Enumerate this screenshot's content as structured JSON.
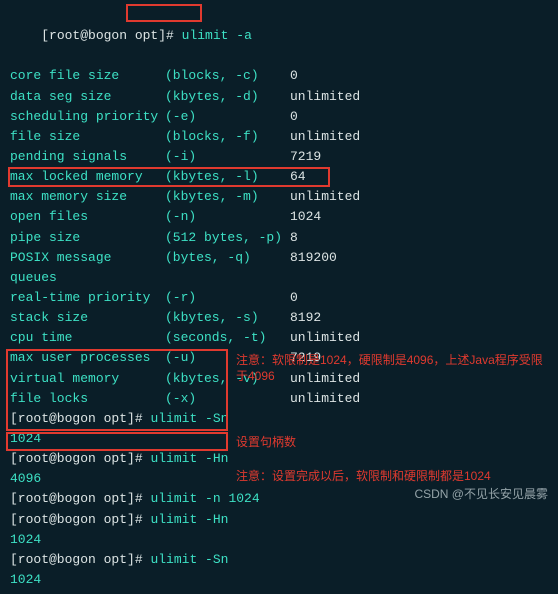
{
  "cmd1": {
    "prompt": "[root@bogon opt]#",
    "cmd": "ulimit -a"
  },
  "limits": [
    {
      "name": "core file size",
      "unit": "(blocks, -c)",
      "val": "0"
    },
    {
      "name": "data seg size",
      "unit": "(kbytes, -d)",
      "val": "unlimited"
    },
    {
      "name": "scheduling priority",
      "unit": "        (-e)",
      "val": "0"
    },
    {
      "name": "file size",
      "unit": "(blocks, -f)",
      "val": "unlimited"
    },
    {
      "name": "pending signals",
      "unit": "        (-i)",
      "val": "7219"
    },
    {
      "name": "max locked memory",
      "unit": "(kbytes, -l)",
      "val": "64"
    },
    {
      "name": "max memory size",
      "unit": "(kbytes, -m)",
      "val": "unlimited"
    },
    {
      "name": "open files",
      "unit": "        (-n)",
      "val": "1024"
    },
    {
      "name": "pipe size",
      "unit": "(512 bytes, -p)",
      "val": "8"
    },
    {
      "name": "POSIX message queues",
      "unit": " (bytes, -q)",
      "val": "819200"
    },
    {
      "name": "real-time priority",
      "unit": "        (-r)",
      "val": "0"
    },
    {
      "name": "stack size",
      "unit": "(kbytes, -s)",
      "val": "8192"
    },
    {
      "name": "cpu time",
      "unit": "(seconds, -t)",
      "val": "unlimited"
    },
    {
      "name": "max user processes",
      "unit": "        (-u)",
      "val": "7219"
    },
    {
      "name": "virtual memory",
      "unit": "(kbytes, -v)",
      "val": "unlimited"
    },
    {
      "name": "file locks",
      "unit": "        (-x)",
      "val": "unlimited"
    }
  ],
  "block2": {
    "p1_prompt": "[root@bogon opt]#",
    "p1_cmd": "ulimit -Sn",
    "p1_out": "1024",
    "p2_prompt": "[root@bogon opt]#",
    "p2_cmd": "ulimit -Hn",
    "p2_out": "4096"
  },
  "block3": {
    "p1_prompt": "[root@bogon opt]#",
    "p1_cmd": "ulimit -n 1024",
    "p2_prompt": "[root@bogon opt]#",
    "p2_cmd": "ulimit -Hn",
    "p2_out": "1024",
    "p3_prompt": "[root@bogon opt]#",
    "p3_cmd": "ulimit -Sn",
    "p3_out": "1024"
  },
  "notes": {
    "n1": "注意：软限制是1024，硬限制是4096，上述Java程序受限于4096",
    "n2": "设置句柄数",
    "n3": "注意：设置完成以后，软限制和硬限制都是1024"
  },
  "watermark": "CSDN @不见长安见晨雾"
}
